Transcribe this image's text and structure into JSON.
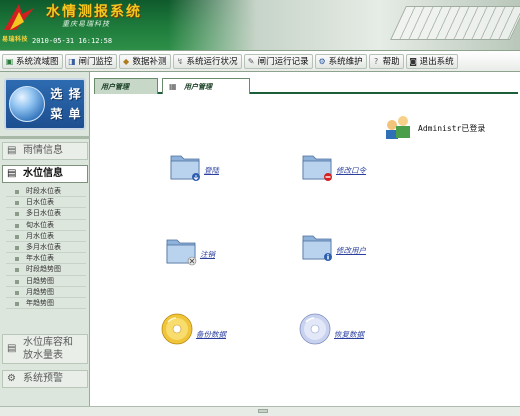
{
  "header": {
    "title": "水情测报系统",
    "subtitle": "重庆易瑞科技",
    "logo_caption": "易瑞科技",
    "datetime": "2010-05-31 16:12:58"
  },
  "toolbar": {
    "items": [
      {
        "label": "系统流域图",
        "icon": "map-icon"
      },
      {
        "label": "闸门监控",
        "icon": "gate-icon"
      },
      {
        "label": "数据补测",
        "icon": "data-icon"
      },
      {
        "label": "系统运行状况",
        "icon": "status-icon"
      },
      {
        "label": "闸门运行记录",
        "icon": "log-icon"
      },
      {
        "label": "系统维护",
        "icon": "wrench-icon"
      },
      {
        "label": "帮助",
        "icon": "help-icon"
      },
      {
        "label": "退出系统",
        "icon": "exit-icon"
      }
    ]
  },
  "sidebar": {
    "badge_line1": "选 择",
    "badge_line2": "菜 单",
    "categories": {
      "rain": "雨情信息",
      "water": "水位信息",
      "storage_line1": "水位库容和",
      "storage_line2": "放水量表",
      "alarm": "系统预警"
    },
    "water_items": [
      "时段水位表",
      "日水位表",
      "多日水位表",
      "旬水位表",
      "月水位表",
      "多月水位表",
      "年水位表",
      "时段趋势图",
      "日趋势图",
      "月趋势图",
      "年趋势图"
    ]
  },
  "content": {
    "tabs": [
      {
        "label": "用户管理"
      },
      {
        "label": "用户管理"
      }
    ],
    "user_name": "Administr",
    "user_status": "已登录",
    "actions": {
      "login": "登陆",
      "change_password": "修改口令",
      "logout": "注销",
      "edit_user": "修改用户",
      "backup": "备份数据",
      "restore": "恢复数据"
    }
  },
  "colors": {
    "header_green": "#1f7c3c",
    "title_gold": "#f3c720",
    "link_blue": "#2a3f9e",
    "sidebar_bg": "#dde6dc"
  }
}
